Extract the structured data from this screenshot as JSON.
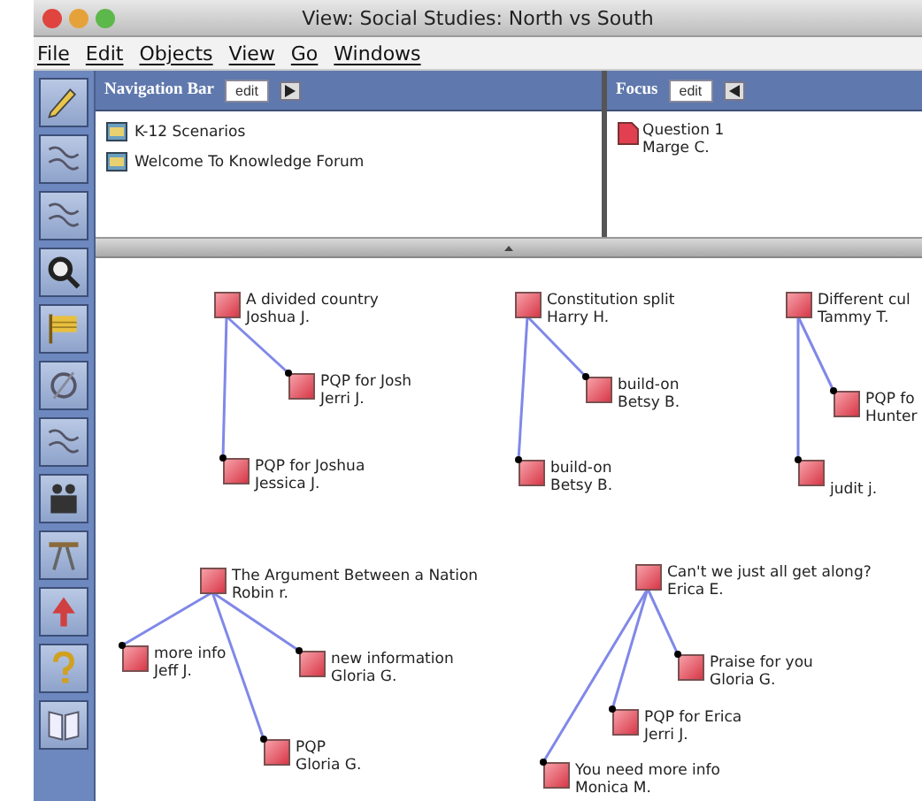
{
  "window": {
    "title": "View: Social Studies: North vs South"
  },
  "menu": [
    "File",
    "Edit",
    "Objects",
    "View",
    "Go",
    "Windows"
  ],
  "navigation_bar": {
    "title": "Navigation Bar",
    "edit_button": "edit",
    "items": [
      "K-12 Scenarios",
      "Welcome To Knowledge Forum"
    ]
  },
  "focus": {
    "title": "Focus",
    "edit_button": "edit",
    "items": [
      {
        "title": "Question 1",
        "author": "Marge C."
      }
    ]
  },
  "canvas": {
    "threads": [
      {
        "title": "A divided country",
        "author": "Joshua J.",
        "children": [
          {
            "title": "PQP for Josh",
            "author": "Jerri J."
          },
          {
            "title": "PQP for Joshua",
            "author": "Jessica J."
          }
        ]
      },
      {
        "title": "Constitution split",
        "author": "Harry H.",
        "children": [
          {
            "title": "build-on",
            "author": "Betsy B."
          },
          {
            "title": "build-on",
            "author": "Betsy B."
          }
        ]
      },
      {
        "title": "Different cul",
        "author": "Tammy T.",
        "children": [
          {
            "title": "PQP fo",
            "author": "Hunter"
          },
          {
            "author": "judit j."
          }
        ]
      },
      {
        "title": "The Argument Between a Nation",
        "author": "Robin r.",
        "children": [
          {
            "title": "more info",
            "author": "Jeff J."
          },
          {
            "title": "new information",
            "author": "Gloria G."
          },
          {
            "title": "PQP",
            "author": "Gloria G."
          }
        ]
      },
      {
        "title": "Can't we just all get along?",
        "author": "Erica E.",
        "children": [
          {
            "title": "Praise for you",
            "author": "Gloria G."
          },
          {
            "title": "PQP for Erica",
            "author": "Jerri J."
          },
          {
            "title": "You need more info",
            "author": "Monica M."
          }
        ]
      }
    ]
  }
}
